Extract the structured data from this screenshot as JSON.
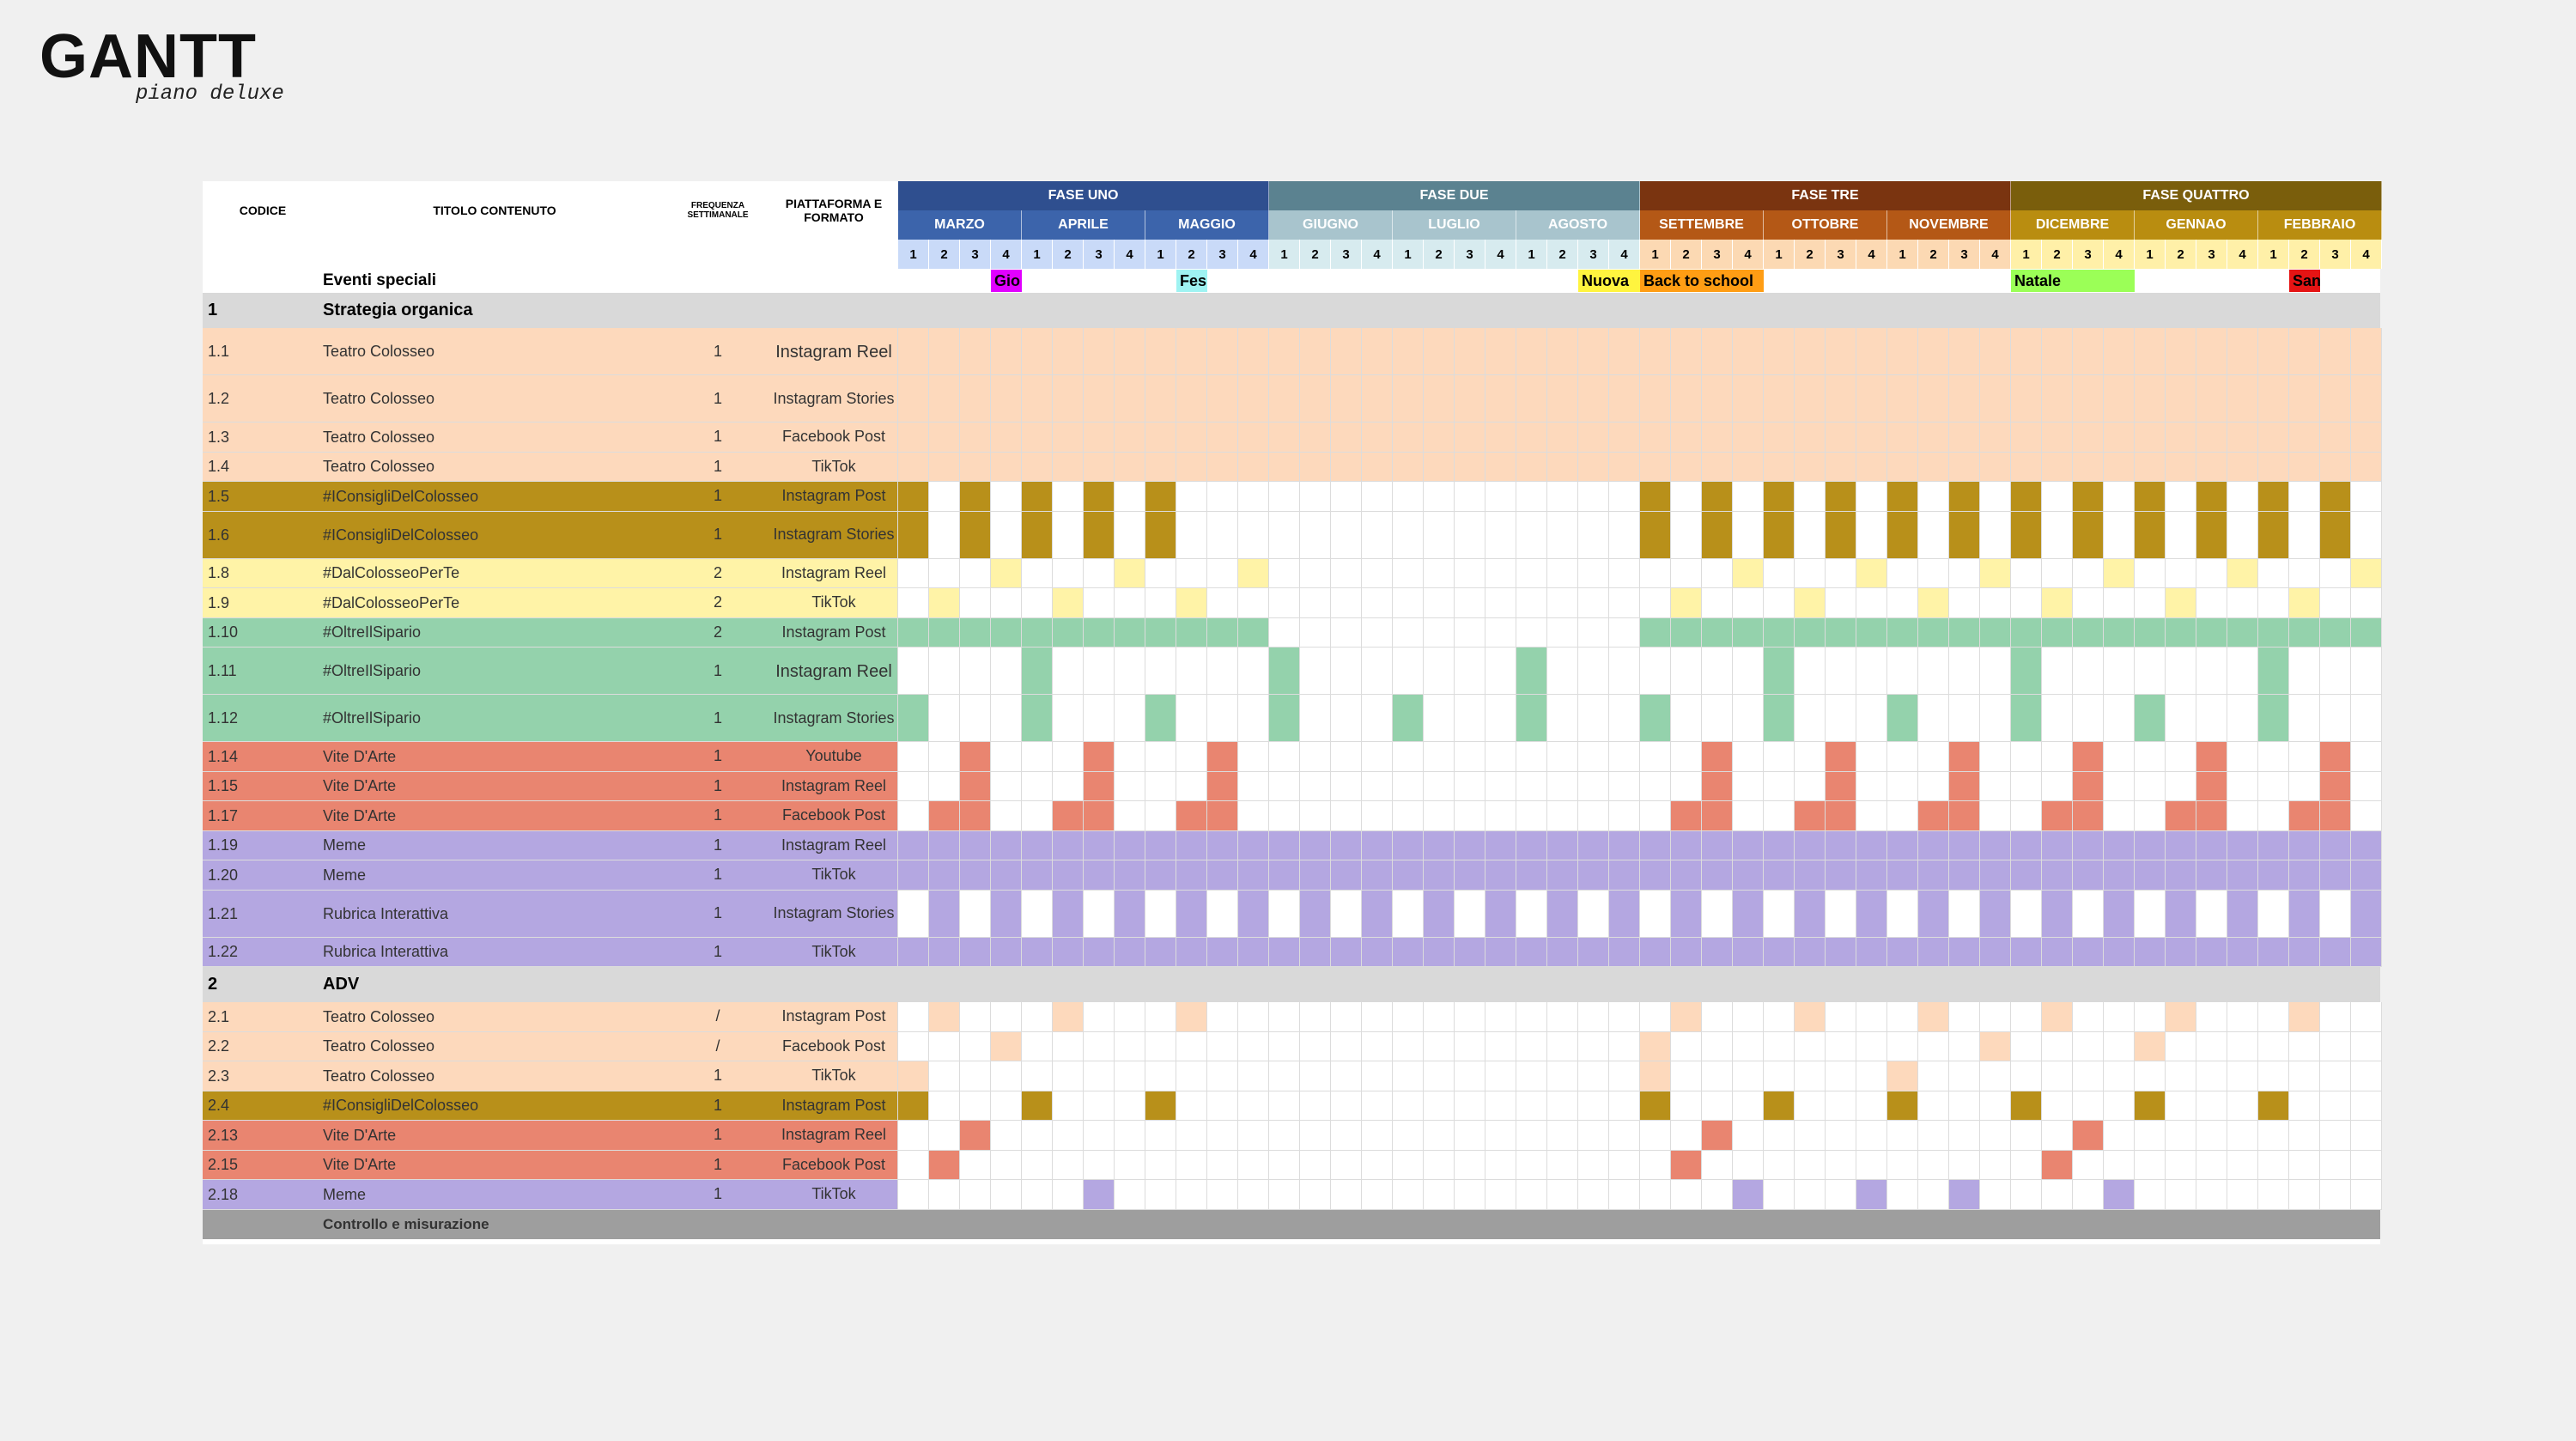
{
  "logo": {
    "title": "GANTT",
    "subtitle": "piano deluxe"
  },
  "headers": {
    "code": "CODICE",
    "title": "TITOLO CONTENUTO",
    "freq": "FREQUENZA SETTIMANALE",
    "platform": "PIATTAFORMA E FORMATO"
  },
  "phases": [
    {
      "label": "FASE UNO",
      "color": "#2f4f8f",
      "months": [
        {
          "label": "MARZO",
          "color": "#3c64ab",
          "weekbg": "#c9daf8"
        },
        {
          "label": "APRILE",
          "color": "#3c64ab",
          "weekbg": "#c9daf8"
        },
        {
          "label": "MAGGIO",
          "color": "#3c64ab",
          "weekbg": "#c9daf8"
        }
      ]
    },
    {
      "label": "FASE DUE",
      "color": "#5b8290",
      "months": [
        {
          "label": "GIUGNO",
          "color": "#a8c4cd",
          "weekbg": "#d7ebef"
        },
        {
          "label": "LUGLIO",
          "color": "#a8c4cd",
          "weekbg": "#d7ebef"
        },
        {
          "label": "AGOSTO",
          "color": "#a8c4cd",
          "weekbg": "#d7ebef"
        }
      ]
    },
    {
      "label": "FASE TRE",
      "color": "#7a3410",
      "months": [
        {
          "label": "SETTEMBRE",
          "color": "#b45816",
          "weekbg": "#fcd9b3"
        },
        {
          "label": "OTTOBRE",
          "color": "#b45816",
          "weekbg": "#fcd9b3"
        },
        {
          "label": "NOVEMBRE",
          "color": "#b45816",
          "weekbg": "#fcd9b3"
        }
      ]
    },
    {
      "label": "FASE QUATTRO",
      "color": "#7a5e0c",
      "months": [
        {
          "label": "DICEMBRE",
          "color": "#b98d10",
          "weekbg": "#fff0a8"
        },
        {
          "label": "GENNAO",
          "color": "#b98d10",
          "weekbg": "#fff0a8"
        },
        {
          "label": "FEBBRAIO",
          "color": "#b98d10",
          "weekbg": "#fff0a8"
        }
      ]
    }
  ],
  "week_labels": [
    "1",
    "2",
    "3",
    "4"
  ],
  "events_label": "Eventi speciali",
  "events": [
    {
      "label": "Gio",
      "week": 3,
      "span": 1,
      "color": "#e100ff"
    },
    {
      "label": "Fes",
      "week": 9,
      "span": 1,
      "color": "#9ff3f2"
    },
    {
      "label": "Nuova",
      "week": 22,
      "span": 2,
      "color": "#fff43f"
    },
    {
      "label": "Back to school",
      "week": 24,
      "span": 4,
      "color": "#ff9d14"
    },
    {
      "label": "Natale",
      "week": 36,
      "span": 4,
      "color": "#9bff57"
    },
    {
      "label": "San",
      "week": 45,
      "span": 1,
      "color": "#e51414"
    }
  ],
  "colors": {
    "peach": "#fdd9bc",
    "gold": "#b8901a",
    "yellow": "#fff3a7",
    "green": "#94d2ac",
    "red": "#e98570",
    "purple": "#b4a7e1",
    "section": "#d9d9d9",
    "footer": "#9e9e9e"
  },
  "rows": [
    {
      "type": "section",
      "code": "1",
      "title": "Strategia organica"
    },
    {
      "code": "1.1",
      "title": "Teatro Colosseo",
      "freq": "1",
      "platform": "Instagram Reel",
      "color": "peach",
      "tall": true,
      "pattern": "all"
    },
    {
      "code": "1.2",
      "title": "Teatro Colosseo",
      "freq": "1",
      "platform": "Instagram Stories",
      "color": "peach",
      "tall": true,
      "pattern": "all"
    },
    {
      "code": "1.3",
      "title": "Teatro Colosseo",
      "freq": "1",
      "platform": "Facebook Post",
      "color": "peach",
      "pattern": "all"
    },
    {
      "code": "1.4",
      "title": "Teatro Colosseo",
      "freq": "1",
      "platform": "TikTok",
      "color": "peach",
      "pattern": "all"
    },
    {
      "code": "1.5",
      "title": "#IConsigliDelColosseo",
      "freq": "1",
      "platform": "Instagram Post",
      "color": "gold",
      "pattern": "gold"
    },
    {
      "code": "1.6",
      "title": "#IConsigliDelColosseo",
      "freq": "1",
      "platform": "Instagram Stories",
      "color": "gold",
      "tall": true,
      "pattern": "gold"
    },
    {
      "code": "1.8",
      "title": "#DalColosseoPerTe",
      "freq": "2",
      "platform": "Instagram Reel",
      "color": "yellow",
      "pattern": "y1"
    },
    {
      "code": "1.9",
      "title": "#DalColosseoPerTe",
      "freq": "2",
      "platform": "TikTok",
      "color": "yellow",
      "pattern": "y2"
    },
    {
      "code": "1.10",
      "title": "#OltreIlSipario",
      "freq": "2",
      "platform": "Instagram Post",
      "color": "green",
      "pattern": "g1"
    },
    {
      "code": "1.11",
      "title": "#OltreIlSipario",
      "freq": "1",
      "platform": "Instagram Reel",
      "color": "green",
      "tall": true,
      "pattern": "g2"
    },
    {
      "code": "1.12",
      "title": "#OltreIlSipario",
      "freq": "1",
      "platform": "Instagram Stories",
      "color": "green",
      "tall": true,
      "pattern": "g3"
    },
    {
      "code": "1.14",
      "title": "Vite D'Arte",
      "freq": "1",
      "platform": "Youtube",
      "color": "red",
      "pattern": "r1"
    },
    {
      "code": "1.15",
      "title": "Vite D'Arte",
      "freq": "1",
      "platform": "Instagram Reel",
      "color": "red",
      "pattern": "r2"
    },
    {
      "code": "1.17",
      "title": "Vite D'Arte",
      "freq": "1",
      "platform": "Facebook Post",
      "color": "red",
      "pattern": "r3"
    },
    {
      "code": "1.19",
      "title": "Meme",
      "freq": "1",
      "platform": "Instagram Reel",
      "color": "purple",
      "pattern": "all"
    },
    {
      "code": "1.20",
      "title": "Meme",
      "freq": "1",
      "platform": "TikTok",
      "color": "purple",
      "pattern": "all"
    },
    {
      "code": "1.21",
      "title": "Rubrica Interattiva",
      "freq": "1",
      "platform": "Instagram Stories",
      "color": "purple",
      "tall": true,
      "pattern": "p1"
    },
    {
      "code": "1.22",
      "title": "Rubrica Interattiva",
      "freq": "1",
      "platform": "TikTok",
      "color": "purple",
      "pattern": "all"
    },
    {
      "type": "section",
      "code": "2",
      "title": "ADV"
    },
    {
      "code": "2.1",
      "title": "Teatro Colosseo",
      "freq": "/",
      "platform": "Instagram Post",
      "color": "peach",
      "pattern": "a1"
    },
    {
      "code": "2.2",
      "title": "Teatro Colosseo",
      "freq": "/",
      "platform": "Facebook Post",
      "color": "peach",
      "pattern": "a2"
    },
    {
      "code": "2.3",
      "title": "Teatro Colosseo",
      "freq": "1",
      "platform": "TikTok",
      "color": "peach",
      "pattern": "a3"
    },
    {
      "code": "2.4",
      "title": "#IConsigliDelColosseo",
      "freq": "1",
      "platform": "Instagram Post",
      "color": "gold",
      "pattern": "a4"
    },
    {
      "code": "2.13",
      "title": "Vite D'Arte",
      "freq": "1",
      "platform": "Instagram Reel",
      "color": "red",
      "pattern": "a5"
    },
    {
      "code": "2.15",
      "title": "Vite D'Arte",
      "freq": "1",
      "platform": "Facebook Post",
      "color": "red",
      "pattern": "a6"
    },
    {
      "code": "2.18",
      "title": "Meme",
      "freq": "1",
      "platform": "TikTok",
      "color": "purple",
      "pattern": "a7"
    },
    {
      "type": "footer",
      "code": "",
      "title": "Controllo e misurazione"
    }
  ]
}
